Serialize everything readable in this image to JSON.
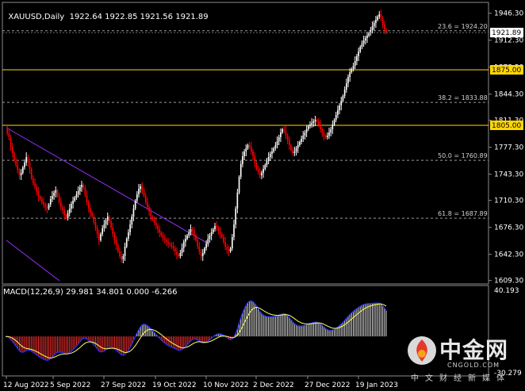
{
  "header": {
    "symbol": "XAUUSD,Daily",
    "open": "1922.64",
    "high": "1922.85",
    "low": "1921.56",
    "close": "1921.89"
  },
  "colors": {
    "background": "#000000",
    "bull": "#ffffff",
    "bear": "#ff0000",
    "grid": "#505050",
    "level_line": "#ffd700",
    "trendline": "#9b30ff",
    "macd_line": "#2233ff",
    "signal_line": "#ffff66"
  },
  "price_axis": {
    "ticks": [
      "1946.30",
      "1912.30",
      "1878.30",
      "1844.30",
      "1811.30",
      "1777.30",
      "1743.30",
      "1710.30",
      "1676.30",
      "1642.30",
      "1609.30"
    ],
    "current_price_label": "1921.89",
    "level_labels": [
      "1875.00",
      "1805.00"
    ]
  },
  "fib_levels": [
    {
      "label": "23.6 = 1924.20",
      "value": 1924.2
    },
    {
      "label": "38.2 = 1833.88",
      "value": 1833.88
    },
    {
      "label": "50.0 = 1760.89",
      "value": 1760.89
    },
    {
      "label": "61.8 = 1687.89",
      "value": 1687.89
    }
  ],
  "horizontal_levels": [
    {
      "label": "1875.00",
      "value": 1875.0
    },
    {
      "label": "1805.00",
      "value": 1805.0
    }
  ],
  "macd": {
    "title": "MACD(12,26,9) 29.981 34.801 0.000 -6.266",
    "axis_top": "40.193",
    "axis_bottom": "-30.279"
  },
  "time_axis": {
    "labels": [
      "12 Aug 2022",
      "5 Sep 2022",
      "27 Sep 2022",
      "19 Oct 2022",
      "10 Nov 2022",
      "2 Dec 2022",
      "27 Dec 2022",
      "19 Jan 2023"
    ]
  },
  "watermark": {
    "name": "中金网",
    "url": "CNGOLD.COM",
    "slogan": "中文财经新媒体"
  },
  "chart_data": {
    "type": "candlestick",
    "symbol": "XAUUSD",
    "timeframe": "Daily",
    "ylim": [
      1605,
      1960
    ],
    "x_labels": [
      "12 Aug 2022",
      "5 Sep 2022",
      "27 Sep 2022",
      "19 Oct 2022",
      "10 Nov 2022",
      "2 Dec 2022",
      "27 Dec 2022",
      "19 Jan 2023"
    ],
    "close_path": [
      1800,
      1795,
      1790,
      1778,
      1770,
      1760,
      1755,
      1748,
      1742,
      1745,
      1752,
      1758,
      1765,
      1758,
      1750,
      1738,
      1732,
      1728,
      1722,
      1715,
      1712,
      1708,
      1705,
      1702,
      1700,
      1705,
      1712,
      1716,
      1720,
      1723,
      1716,
      1708,
      1702,
      1698,
      1692,
      1688,
      1694,
      1700,
      1706,
      1710,
      1714,
      1718,
      1722,
      1727,
      1730,
      1726,
      1717,
      1708,
      1700,
      1695,
      1690,
      1683,
      1676,
      1668,
      1660,
      1668,
      1675,
      1680,
      1685,
      1690,
      1684,
      1676,
      1668,
      1660,
      1654,
      1646,
      1640,
      1636,
      1640,
      1652,
      1662,
      1670,
      1680,
      1690,
      1700,
      1710,
      1718,
      1725,
      1728,
      1724,
      1716,
      1708,
      1702,
      1696,
      1690,
      1686,
      1682,
      1678,
      1674,
      1670,
      1666,
      1662,
      1660,
      1658,
      1656,
      1654,
      1652,
      1650,
      1646,
      1642,
      1640,
      1644,
      1650,
      1658,
      1662,
      1666,
      1670,
      1674,
      1672,
      1666,
      1660,
      1652,
      1646,
      1640,
      1644,
      1650,
      1656,
      1662,
      1666,
      1670,
      1674,
      1678,
      1676,
      1672,
      1668,
      1664,
      1658,
      1652,
      1648,
      1646,
      1650,
      1664,
      1680,
      1700,
      1720,
      1740,
      1756,
      1766,
      1772,
      1776,
      1780,
      1778,
      1772,
      1766,
      1758,
      1750,
      1746,
      1742,
      1745,
      1750,
      1755,
      1760,
      1765,
      1769,
      1772,
      1776,
      1780,
      1785,
      1790,
      1796,
      1800,
      1798,
      1792,
      1786,
      1780,
      1774,
      1770,
      1772,
      1776,
      1780,
      1784,
      1788,
      1792,
      1796,
      1800,
      1804,
      1806,
      1808,
      1810,
      1812,
      1810,
      1806,
      1800,
      1795,
      1792,
      1790,
      1792,
      1796,
      1800,
      1806,
      1812,
      1818,
      1824,
      1830,
      1836,
      1842,
      1850,
      1858,
      1866,
      1872,
      1876,
      1880,
      1886,
      1892,
      1898,
      1904,
      1908,
      1912,
      1915,
      1918,
      1921,
      1925,
      1930,
      1934,
      1938,
      1942,
      1945,
      1940,
      1932,
      1926,
      1922
    ]
  }
}
